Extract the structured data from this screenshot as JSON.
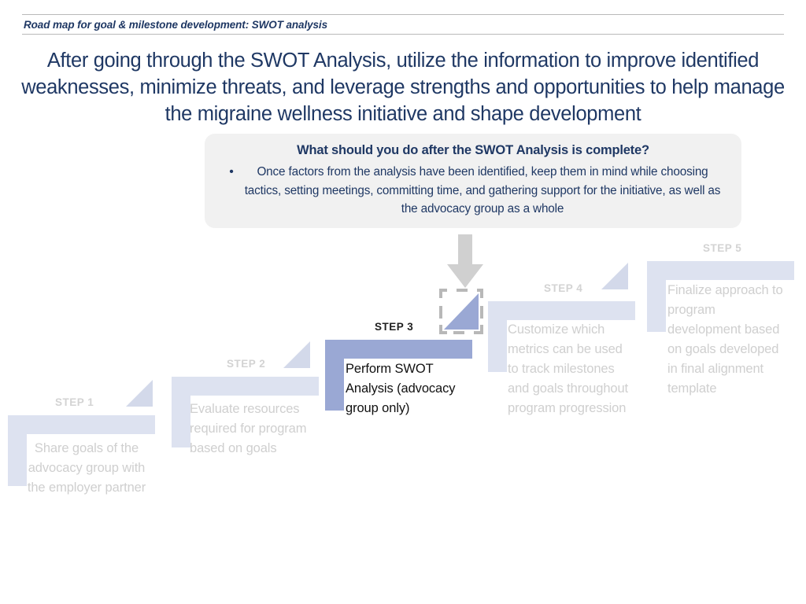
{
  "header": {
    "subtitle": "Road map for goal & milestone development: SWOT analysis"
  },
  "title": {
    "text": "After going through the SWOT Analysis, utilize the information to improve identified weaknesses, minimize threats, and leverage strengths and opportunities to help manage the migraine wellness initiative and shape development"
  },
  "callout": {
    "heading": "What should you do after the SWOT Analysis is complete?",
    "bullet_marker": "•",
    "bullet": "Once factors from the analysis have been identified, keep them in mind while choosing tactics, setting meetings, committing time, and gathering support for the initiative, as well as the advocacy group as a whole"
  },
  "staircase": {
    "steps": [
      {
        "label": "STEP 1",
        "text": "Share goals of the advocacy group with the employer partner",
        "state": "inactive",
        "align": "center"
      },
      {
        "label": "STEP 2",
        "text": "Evaluate resources required for program based on goals",
        "state": "inactive",
        "align": "left"
      },
      {
        "label": "STEP 3",
        "text": "Perform SWOT Analysis (advocacy group only)",
        "state": "active",
        "align": "left"
      },
      {
        "label": "STEP 4",
        "text": "Customize which metrics can be used to track milestones and goals throughout program progression",
        "state": "inactive",
        "align": "left"
      },
      {
        "label": "STEP 5",
        "text": "Finalize approach to program development based on goals developed in final alignment template",
        "state": "inactive",
        "align": "left"
      }
    ]
  },
  "colors": {
    "navy": "#1f3864",
    "active_bar": "#9aa8d4",
    "inactive_bar": "#dde2f0",
    "inactive_text": "#cfcfcf",
    "callout_bg": "#f1f1f1",
    "arrow_gray": "#d0d0d0"
  },
  "icons": {
    "down_arrow": "down-arrow-icon",
    "image_placeholder": "image-placeholder-icon"
  }
}
